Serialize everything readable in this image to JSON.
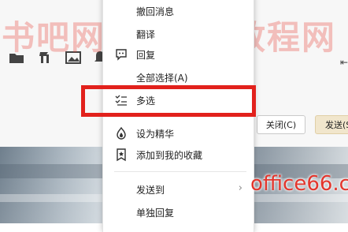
{
  "background": {
    "close_button": "关闭(C)",
    "send_button": "发送(S",
    "toolbar_icons": [
      "folder-icon",
      "cut-icon",
      "image-icon",
      "bell-icon"
    ]
  },
  "context_menu": {
    "items": [
      {
        "label": "撤回消息",
        "icon": null
      },
      {
        "label": "翻译",
        "icon": null
      },
      {
        "label": "回复",
        "icon": "reply-icon"
      },
      {
        "label": "全部选择(A)",
        "icon": null
      },
      {
        "label": "多选",
        "icon": "multi-select-icon"
      },
      {
        "label": "设为精华",
        "icon": "highlight-icon"
      },
      {
        "label": "添加到我的收藏",
        "icon": "favorite-icon"
      },
      {
        "label": "发送到",
        "icon": null,
        "submenu": true
      },
      {
        "label": "单独回复",
        "icon": null
      }
    ]
  },
  "highlight_color": "#e2211c",
  "watermark": {
    "top": "书吧网 office教程网",
    "bottom": "office66.cn"
  }
}
